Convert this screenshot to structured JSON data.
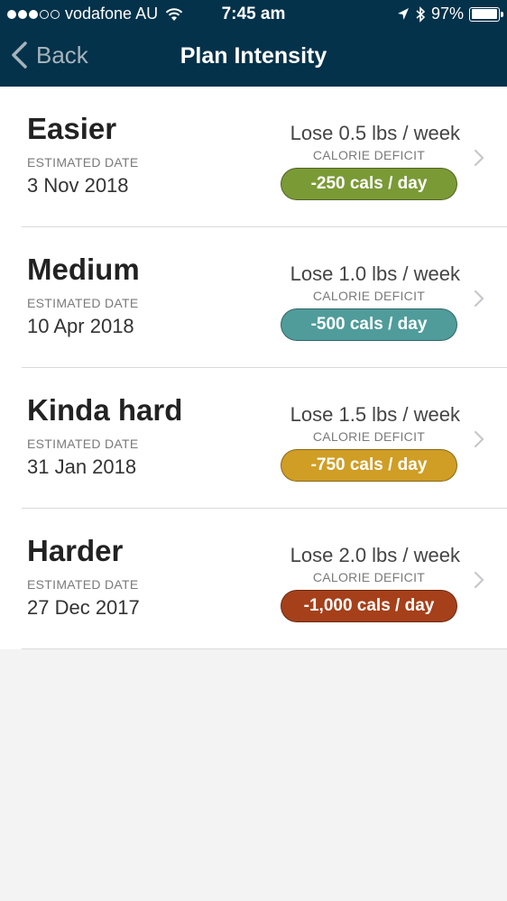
{
  "status_bar": {
    "carrier": "vodafone AU",
    "signal_bars": 3,
    "signal_max": 5,
    "time": "7:45 am",
    "battery": "97%",
    "battery_level": 0.97,
    "icons": [
      "wifi-icon",
      "location-arrow-icon",
      "bluetooth-icon",
      "battery-icon"
    ]
  },
  "nav": {
    "back_label": "Back",
    "title": "Plan Intensity"
  },
  "plans": [
    {
      "name": "Easier",
      "estimated_label": "ESTIMATED DATE",
      "date": "3 Nov 2018",
      "rate": "Lose 0.5 lbs / week",
      "deficit_label": "CALORIE DEFICIT",
      "deficit": "-250 cals / day",
      "color": "#7a9a36"
    },
    {
      "name": "Medium",
      "estimated_label": "ESTIMATED DATE",
      "date": "10 Apr 2018",
      "rate": "Lose 1.0 lbs / week",
      "deficit_label": "CALORIE DEFICIT",
      "deficit": "-500 cals / day",
      "color": "#4f9c9b"
    },
    {
      "name": "Kinda hard",
      "estimated_label": "ESTIMATED DATE",
      "date": "31 Jan 2018",
      "rate": "Lose 1.5 lbs / week",
      "deficit_label": "CALORIE DEFICIT",
      "deficit": "-750 cals / day",
      "color": "#d09e25"
    },
    {
      "name": "Harder",
      "estimated_label": "ESTIMATED DATE",
      "date": "27 Dec 2017",
      "rate": "Lose 2.0 lbs / week",
      "deficit_label": "CALORIE DEFICIT",
      "deficit": "-1,000 cals / day",
      "color": "#a5401a"
    }
  ]
}
